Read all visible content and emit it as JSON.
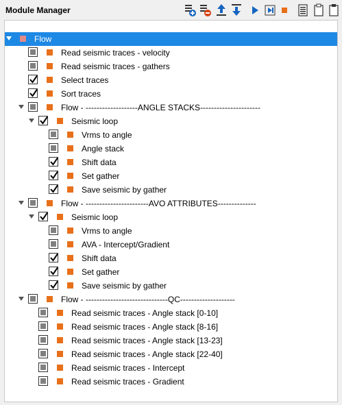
{
  "panel": {
    "title": "Module Manager"
  },
  "toolbar": {
    "buttons": [
      {
        "icon": "add-module-icon"
      },
      {
        "icon": "remove-module-icon"
      },
      {
        "icon": "move-up-icon"
      },
      {
        "icon": "move-down-icon"
      },
      {
        "icon": "run-icon"
      },
      {
        "icon": "run-to-cursor-icon"
      },
      {
        "icon": "stop-icon"
      },
      {
        "icon": "list-icon"
      },
      {
        "icon": "clipboard-copy-icon"
      },
      {
        "icon": "clipboard-paste-icon"
      }
    ]
  },
  "colors": {
    "selection": "#1e88e5",
    "module_square": "#e8701a",
    "root_square": "#e08a8a",
    "stop": "#e8701a",
    "run": "#1565c0"
  },
  "tree": {
    "rows": [
      {
        "label": "Flow",
        "level": 0,
        "state": "none",
        "expanded": true,
        "selected": true
      },
      {
        "label": "Read seismic traces - velocity",
        "level": 1,
        "state": "partial"
      },
      {
        "label": "Read seismic traces - gathers",
        "level": 1,
        "state": "partial"
      },
      {
        "label": "Select traces",
        "level": 1,
        "state": "checked"
      },
      {
        "label": "Sort traces",
        "level": 1,
        "state": "checked"
      },
      {
        "label": "Flow - -------------------ANGLE STACKS----------------------",
        "level": 1,
        "state": "partial",
        "expanded": true
      },
      {
        "label": "Seismic loop",
        "level": 2,
        "state": "checked",
        "expanded": true
      },
      {
        "label": "Vrms to angle",
        "level": 3,
        "state": "partial"
      },
      {
        "label": "Angle stack",
        "level": 3,
        "state": "partial"
      },
      {
        "label": "Shift data",
        "level": 3,
        "state": "checked"
      },
      {
        "label": "Set gather",
        "level": 3,
        "state": "checked"
      },
      {
        "label": "Save seismic by gather",
        "level": 3,
        "state": "checked"
      },
      {
        "label": "Flow - -----------------------AVO ATTRIBUTES--------------",
        "level": 1,
        "state": "partial",
        "expanded": true
      },
      {
        "label": "Seismic loop",
        "level": 2,
        "state": "checked",
        "expanded": true
      },
      {
        "label": "Vrms to angle",
        "level": 3,
        "state": "partial"
      },
      {
        "label": "AVA - Intercept/Gradient",
        "level": 3,
        "state": "partial"
      },
      {
        "label": "Shift data",
        "level": 3,
        "state": "checked"
      },
      {
        "label": "Set gather",
        "level": 3,
        "state": "checked"
      },
      {
        "label": "Save seismic by gather",
        "level": 3,
        "state": "checked"
      },
      {
        "label": "Flow - ------------------------------QC--------------------",
        "level": 1,
        "state": "partial",
        "expanded": true
      },
      {
        "label": "Read seismic traces - Angle stack [0-10]",
        "level": 2,
        "state": "partial"
      },
      {
        "label": "Read seismic traces - Angle stack [8-16]",
        "level": 2,
        "state": "partial"
      },
      {
        "label": "Read seismic traces - Angle stack [13-23]",
        "level": 2,
        "state": "partial"
      },
      {
        "label": "Read seismic traces - Angle stack [22-40]",
        "level": 2,
        "state": "partial"
      },
      {
        "label": "Read seismic traces - Intercept",
        "level": 2,
        "state": "partial"
      },
      {
        "label": "Read seismic traces - Gradient",
        "level": 2,
        "state": "partial"
      }
    ]
  }
}
